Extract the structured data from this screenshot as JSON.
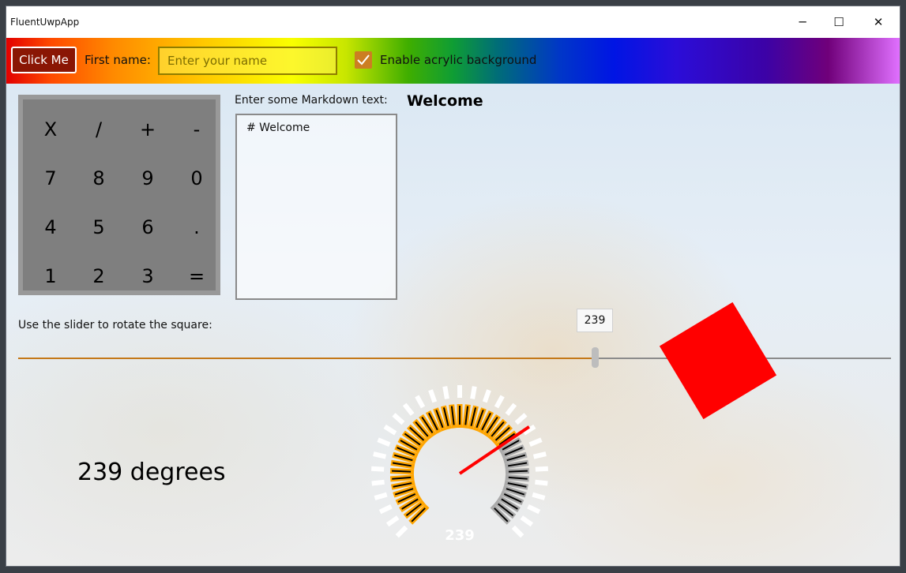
{
  "window": {
    "title": "FluentUwpApp"
  },
  "window_controls": {
    "minimize": "─",
    "maximize": "☐",
    "close": "✕"
  },
  "toolbar": {
    "button_label": "Click Me",
    "first_name_label": "First name:",
    "first_name_placeholder": "Enter your name",
    "first_name_value": "",
    "acrylic_checked": true,
    "acrylic_label": "Enable acrylic background"
  },
  "calculator": {
    "keys": [
      "X",
      "/",
      "+",
      "-",
      "7",
      "8",
      "9",
      "0",
      "4",
      "5",
      "6",
      ".",
      "1",
      "2",
      "3",
      "="
    ]
  },
  "markdown": {
    "label": "Enter some Markdown text:",
    "input": "# Welcome",
    "rendered_heading": "Welcome"
  },
  "slider": {
    "label": "Use the slider to rotate the square:",
    "value": 239,
    "min": 0,
    "max": 360,
    "tooltip": "239"
  },
  "degrees_text": "239 degrees",
  "gauge": {
    "value": 239,
    "value_label": "239",
    "min": 0,
    "max": 360,
    "colors": {
      "filled": "#ffa500",
      "unfilled": "#aaaaaa",
      "needle": "#ff0000",
      "ticks": "#ffffff"
    }
  },
  "colors": {
    "accent": "#c47818",
    "button_bg": "#8a1604",
    "square": "#ff0000"
  }
}
